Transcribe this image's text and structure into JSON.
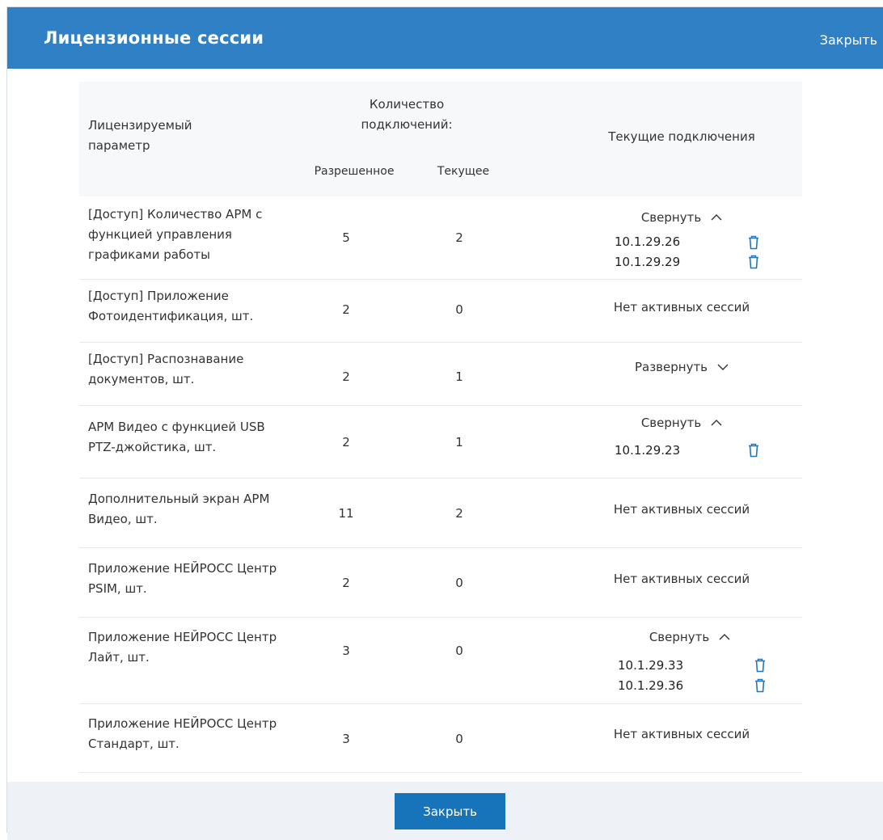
{
  "dialog": {
    "title": "Лицензионные сессии",
    "close_link": "Закрыть",
    "close_button": "Закрыть"
  },
  "table": {
    "headers": {
      "param": "Лицензируемый параметр",
      "count_group": "Количество подключений:",
      "allowed": "Разрешенное",
      "current": "Текущее",
      "sessions": "Текущие подключения"
    },
    "rows": [
      {
        "param": "[Доступ] Количество АРМ с функцией управления графиками работы",
        "allowed": "5",
        "current": "2",
        "sessions_state": "Свернуть",
        "chevron": "^",
        "ips": [
          "10.1.29.26",
          "10.1.29.29"
        ]
      },
      {
        "param": "[Доступ] Приложение Фотоидентификация, шт.",
        "allowed": "2",
        "current": "0",
        "no_sessions": "Нет активных сессий"
      },
      {
        "param": "[Доступ] Распознавание документов, шт.",
        "allowed": "2",
        "current": "1",
        "sessions_state": "Развернуть",
        "chevron": "v"
      },
      {
        "param": "АРМ Видео с функцией USB PTZ-джойстика, шт.",
        "allowed": "2",
        "current": "1",
        "sessions_state": "Свернуть",
        "chevron": "^",
        "ips": [
          "10.1.29.23"
        ]
      },
      {
        "param": "Дополнительный экран АРМ Видео, шт.",
        "allowed": "11",
        "current": "2",
        "no_sessions": "Нет активных сессий"
      },
      {
        "param": "Приложение НЕЙРОСС Центр PSIM, шт.",
        "allowed": "2",
        "current": "0",
        "no_sessions": "Нет активных сессий"
      },
      {
        "param": "Приложение НЕЙРОСС Центр Лайт, шт.",
        "allowed": "3",
        "current": "0",
        "sessions_state": "Свернуть",
        "chevron": "^",
        "ips": [
          "10.1.29.33",
          "10.1.29.36"
        ]
      },
      {
        "param": "Приложение НЕЙРОСС Центр Стандарт, шт.",
        "allowed": "3",
        "current": "0",
        "no_sessions": "Нет активных сессий"
      }
    ]
  },
  "colors": {
    "header_bg": "#2f80c5",
    "button_bg": "#1874ba",
    "icon_color": "#1f78c1",
    "footer_bg": "#eef2f6"
  },
  "icons": {
    "delete": "trash-icon",
    "collapse": "chevron-up-icon",
    "expand": "chevron-down-icon"
  }
}
